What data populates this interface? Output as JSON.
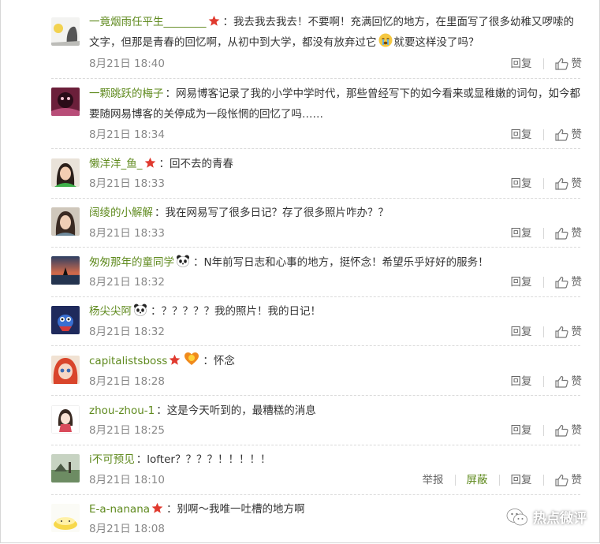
{
  "comments": [
    {
      "user": "一竟烟雨任平生________",
      "text": "我去我去我去！不要啊！充满回忆的地方，在里面写了很多幼稚又啰嗦的文字，但那是青春的回忆啊，从初中到大学，都没有放弃过它",
      "text_tail": "就要这样没了吗？",
      "time": "8月21日 18:40"
    },
    {
      "user": "一颗跳跃的梅子",
      "text": "网易博客记录了我的小学中学时代，那些曾经写下的如今看来或显稚嫩的词句，如今都要随网易博客的关停成为一段怅惘的回忆了吗……",
      "time": "8月21日 18:34"
    },
    {
      "user": "懒洋洋_鱼_",
      "text": "回不去的青春",
      "time": "8月21日 18:33"
    },
    {
      "user": "阔绫的小解解",
      "text": "我在网易写了很多日记？存了很多照片咋办？？",
      "time": "8月21日 18:33"
    },
    {
      "user": "匆匆那年的童同学",
      "text": "N年前写日志和心事的地方，挺怀念！希望乐乎好好的服务！",
      "time": "8月21日 18:32"
    },
    {
      "user": "杨尖尖阿",
      "text": "？？？？？我的照片！我的日记！",
      "time": "8月21日 18:32"
    },
    {
      "user": "capitalistsboss",
      "text": "怀念",
      "time": "8月21日 18:28"
    },
    {
      "user": "zhou-zhou-1",
      "text": "这是今天听到的，最糟糕的消息",
      "time": "8月21日 18:25"
    },
    {
      "user": "i不可预见",
      "text": "lofter？？？？！！！！！",
      "time": "8月21日 18:10",
      "extra_report": "举报",
      "extra_block": "屏蔽"
    },
    {
      "user": "E-a-nanana",
      "text": "别啊～我唯一吐槽的地方啊",
      "time": "8月21日 18:08"
    }
  ],
  "actions": {
    "reply": "回复",
    "like": "赞"
  },
  "watermark": {
    "text": "热点微评",
    "icon": "wechat-icon"
  },
  "colors": {
    "username": "#5f8a1e",
    "text": "#333333",
    "meta": "#888888",
    "star_badge": "#e03a2f"
  }
}
